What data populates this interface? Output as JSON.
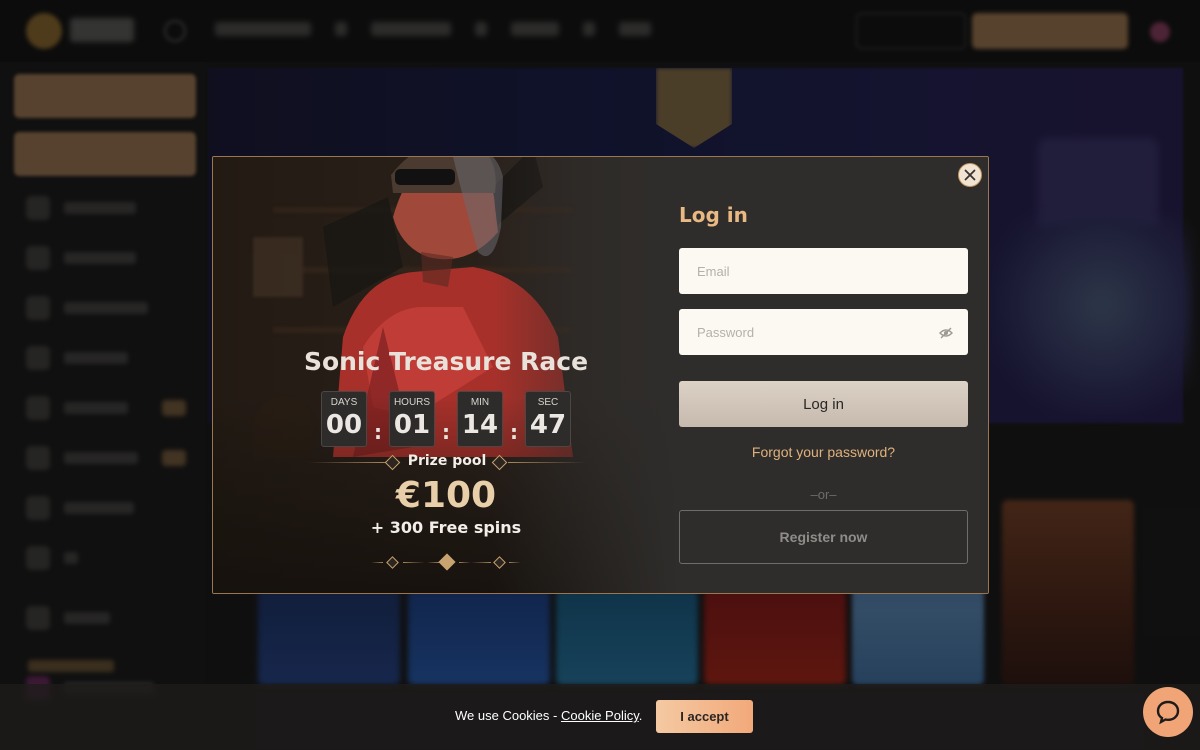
{
  "modal": {
    "promo": {
      "title": "Sonic Treasure Race",
      "countdown": [
        {
          "label": "DAYS",
          "value": "00"
        },
        {
          "label": "HOURS",
          "value": "01"
        },
        {
          "label": "MIN",
          "value": "14"
        },
        {
          "label": "SEC",
          "value": "47"
        }
      ],
      "separator": ":",
      "prize_label": "Prize pool",
      "prize_value": "€100",
      "prize_extra": "+ 300 Free spins"
    },
    "login": {
      "title": "Log in",
      "email_placeholder": "Email",
      "password_placeholder": "Password",
      "login_button": "Log in",
      "forgot_link": "Forgot your password?",
      "or_text": "–or–",
      "register_button": "Register now"
    },
    "close_icon": "close-icon"
  },
  "cookie_bar": {
    "text": "We use Cookies - ",
    "policy_link": "Cookie Policy",
    "period": ".",
    "accept_button": "I accept"
  },
  "colors": {
    "accent": "#e9b983",
    "accept": "#f2a97a",
    "modal_bg": "#2f2d2b"
  }
}
